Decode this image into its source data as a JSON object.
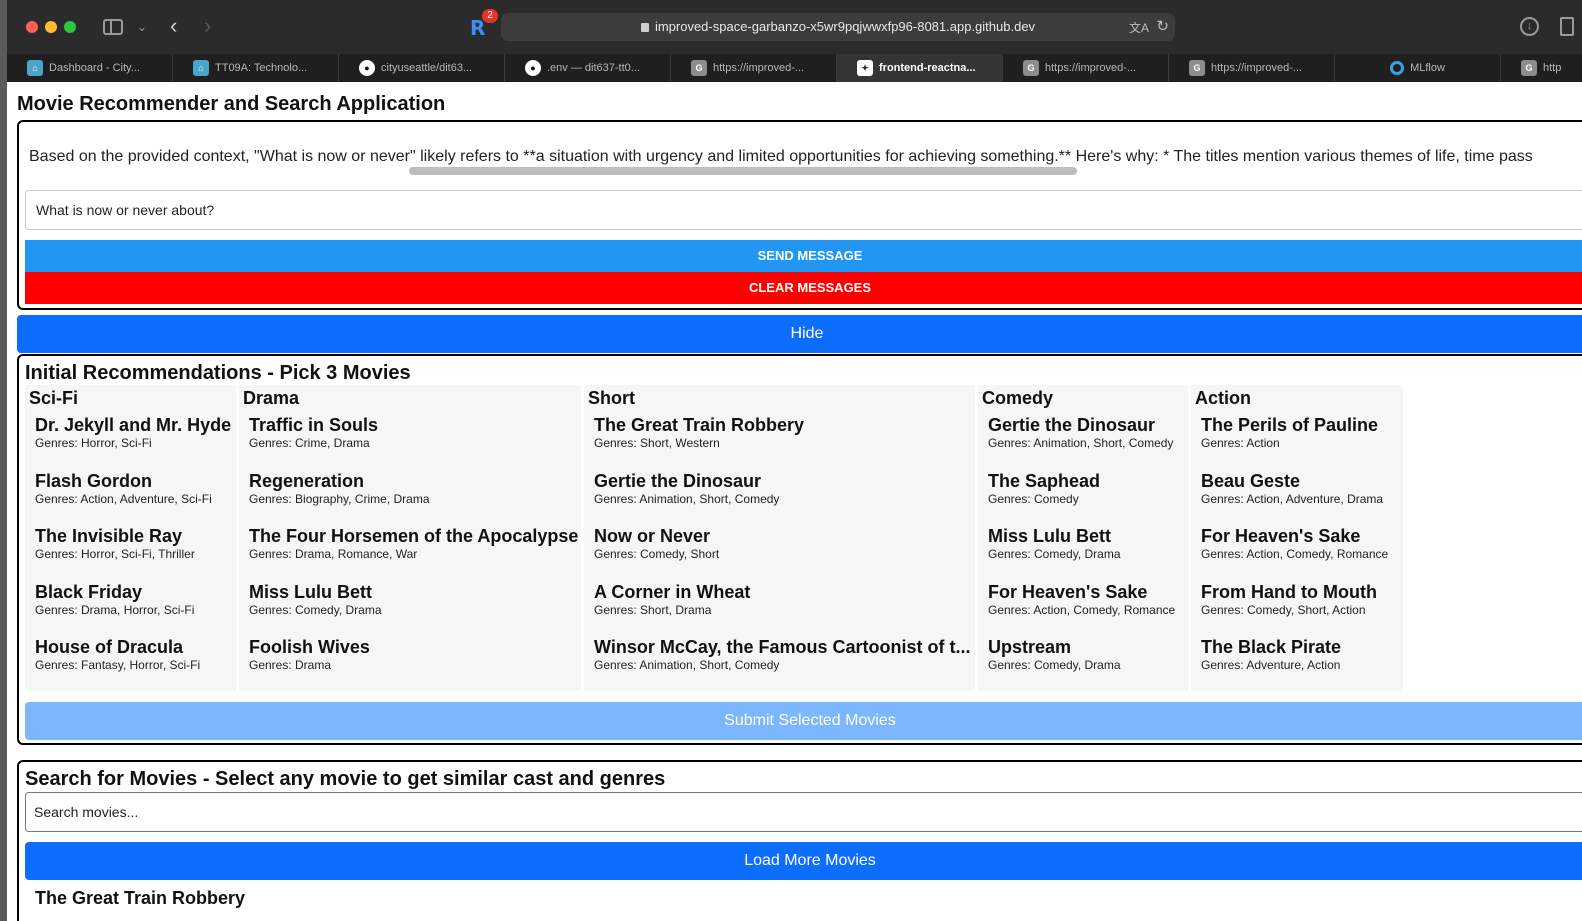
{
  "browser": {
    "url": "improved-space-garbanzo-x5wr9pqjwwxfp96-8081.app.github.dev",
    "extension_badge": "2",
    "tabs": [
      {
        "label": "Dashboard - City...",
        "icon": "city-icon"
      },
      {
        "label": "TT09A: Technolo...",
        "icon": "city-icon"
      },
      {
        "label": "cityuseattle/dit63...",
        "icon": "github-icon"
      },
      {
        "label": ".env — dit637-tt0...",
        "icon": "github-icon"
      },
      {
        "label": "https://improved-...",
        "icon": "g-icon"
      },
      {
        "label": "frontend-reactna...",
        "icon": "figma-icon",
        "active": true
      },
      {
        "label": "https://improved-...",
        "icon": "g-icon"
      },
      {
        "label": "https://improved-...",
        "icon": "g-icon"
      },
      {
        "label": "MLflow",
        "icon": "mlflow-icon"
      },
      {
        "label": "http",
        "icon": "g-icon"
      }
    ]
  },
  "app": {
    "title": "Movie Recommender and Search Application"
  },
  "chat": {
    "message": "Based on the provided context, \"What is now or never\" likely refers to **a situation with urgency and limited opportunities for achieving something.**  Here's why: * The titles mention various themes of life, time pass",
    "input_value": "What is now or never about?",
    "send_label": "SEND MESSAGE",
    "clear_label": "CLEAR MESSAGES"
  },
  "hide_label": "Hide",
  "recommendations": {
    "title": "Initial Recommendations - Pick 3 Movies",
    "submit_label": "Submit Selected Movies",
    "columns": [
      {
        "name": "Sci-Fi",
        "movies": [
          {
            "title": "Dr. Jekyll and Mr. Hyde",
            "genres": "Genres: Horror, Sci-Fi"
          },
          {
            "title": "Flash Gordon",
            "genres": "Genres: Action, Adventure, Sci-Fi"
          },
          {
            "title": "The Invisible Ray",
            "genres": "Genres: Horror, Sci-Fi, Thriller"
          },
          {
            "title": "Black Friday",
            "genres": "Genres: Drama, Horror, Sci-Fi"
          },
          {
            "title": "House of Dracula",
            "genres": "Genres: Fantasy, Horror, Sci-Fi"
          }
        ]
      },
      {
        "name": "Drama",
        "movies": [
          {
            "title": "Traffic in Souls",
            "genres": "Genres: Crime, Drama"
          },
          {
            "title": "Regeneration",
            "genres": "Genres: Biography, Crime, Drama"
          },
          {
            "title": "The Four Horsemen of the Apocalypse",
            "genres": "Genres: Drama, Romance, War"
          },
          {
            "title": "Miss Lulu Bett",
            "genres": "Genres: Comedy, Drama"
          },
          {
            "title": "Foolish Wives",
            "genres": "Genres: Drama"
          }
        ]
      },
      {
        "name": "Short",
        "movies": [
          {
            "title": "The Great Train Robbery",
            "genres": "Genres: Short, Western"
          },
          {
            "title": "Gertie the Dinosaur",
            "genres": "Genres: Animation, Short, Comedy"
          },
          {
            "title": "Now or Never",
            "genres": "Genres: Comedy, Short"
          },
          {
            "title": "A Corner in Wheat",
            "genres": "Genres: Short, Drama"
          },
          {
            "title": "Winsor McCay, the Famous Cartoonist of t...",
            "genres": "Genres: Animation, Short, Comedy"
          }
        ]
      },
      {
        "name": "Comedy",
        "movies": [
          {
            "title": "Gertie the Dinosaur",
            "genres": "Genres: Animation, Short, Comedy"
          },
          {
            "title": "The Saphead",
            "genres": "Genres: Comedy"
          },
          {
            "title": "Miss Lulu Bett",
            "genres": "Genres: Comedy, Drama"
          },
          {
            "title": "For Heaven's Sake",
            "genres": "Genres: Action, Comedy, Romance"
          },
          {
            "title": "Upstream",
            "genres": "Genres: Comedy, Drama"
          }
        ]
      },
      {
        "name": "Action",
        "movies": [
          {
            "title": "The Perils of Pauline",
            "genres": "Genres: Action"
          },
          {
            "title": "Beau Geste",
            "genres": "Genres: Action, Adventure, Drama"
          },
          {
            "title": "For Heaven's Sake",
            "genres": "Genres: Action, Comedy, Romance"
          },
          {
            "title": "From Hand to Mouth",
            "genres": "Genres: Comedy, Short, Action"
          },
          {
            "title": "The Black Pirate",
            "genres": "Genres: Adventure, Action"
          }
        ]
      }
    ]
  },
  "search": {
    "title": "Search for Movies - Select any movie to get similar cast and genres",
    "placeholder": "Search movies...",
    "load_more_label": "Load More Movies",
    "first_result": "The Great Train Robbery"
  }
}
